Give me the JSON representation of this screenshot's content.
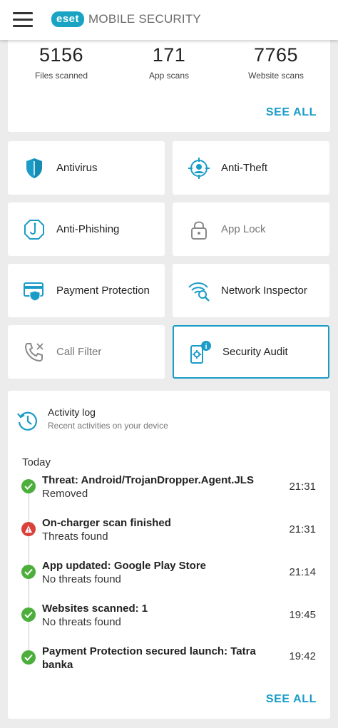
{
  "header": {
    "logo_text": "eset",
    "app_title": "MOBILE SECURITY",
    "menu_icon": "hamburger-menu-icon"
  },
  "stats": {
    "items": [
      {
        "value": "5156",
        "label": "Files scanned"
      },
      {
        "value": "171",
        "label": "App scans"
      },
      {
        "value": "7765",
        "label": "Website scans"
      }
    ],
    "see_all": "SEE ALL"
  },
  "features": [
    {
      "label": "Antivirus",
      "icon": "shield-icon",
      "enabled": true
    },
    {
      "label": "Anti-Theft",
      "icon": "anti-theft-icon",
      "enabled": true
    },
    {
      "label": "Anti-Phishing",
      "icon": "anti-phishing-icon",
      "enabled": true
    },
    {
      "label": "App Lock",
      "icon": "lock-icon",
      "enabled": false
    },
    {
      "label": "Payment Protection",
      "icon": "payment-protection-icon",
      "enabled": true
    },
    {
      "label": "Network Inspector",
      "icon": "network-inspector-icon",
      "enabled": true
    },
    {
      "label": "Call Filter",
      "icon": "phone-icon",
      "enabled": false
    },
    {
      "label": "Security Audit",
      "icon": "security-audit-icon",
      "enabled": true,
      "selected": true
    }
  ],
  "activity": {
    "title": "Activity log",
    "subtitle": "Recent activities on your device",
    "day": "Today",
    "entries": [
      {
        "title": "Threat: Android/TrojanDropper.Agent.JLS",
        "detail": "Removed",
        "time": "21:31",
        "status": "ok"
      },
      {
        "title": "On-charger scan finished",
        "detail": "Threats found",
        "time": "21:31",
        "status": "warning"
      },
      {
        "title": "App updated: Google Play Store",
        "detail": "No threats found",
        "time": "21:14",
        "status": "ok"
      },
      {
        "title": "Websites scanned: 1",
        "detail": "No threats found",
        "time": "19:45",
        "status": "ok"
      },
      {
        "title": "Payment Protection secured launch: Tatra banka",
        "detail": "",
        "time": "19:42",
        "status": "ok"
      }
    ],
    "see_all": "SEE ALL"
  },
  "colors": {
    "accent": "#1a9cc7",
    "ok": "#4caf3c",
    "warning": "#d9413a",
    "disabled": "#8a8a8a"
  }
}
